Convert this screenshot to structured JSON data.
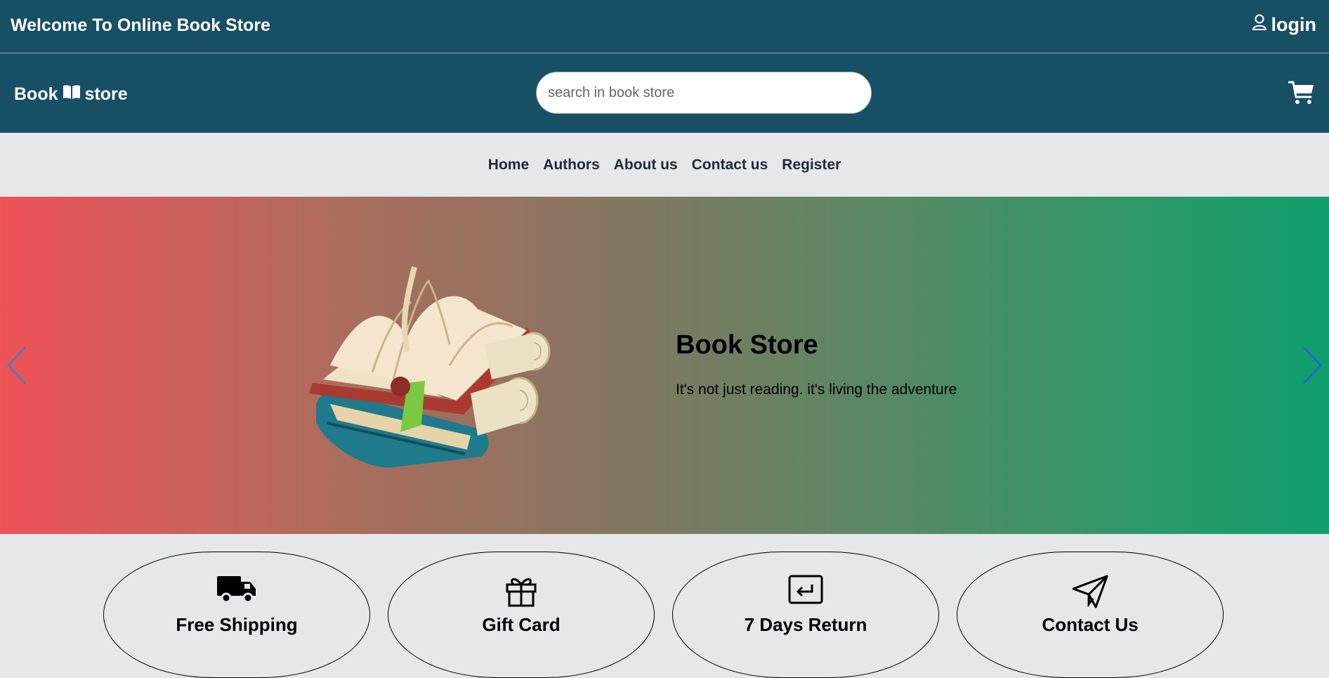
{
  "topbar": {
    "welcome": "Welcome To Online Book Store",
    "login_label": "login"
  },
  "header": {
    "logo_left": "Book",
    "logo_right": "store",
    "search_placeholder": "search in book store",
    "search_value": ""
  },
  "nav": {
    "items": [
      {
        "label": "Home"
      },
      {
        "label": "Authors"
      },
      {
        "label": "About us"
      },
      {
        "label": "Contact us"
      },
      {
        "label": "Register"
      }
    ]
  },
  "hero": {
    "title": "Book Store",
    "tagline": "It's not just reading. it's living the adventure",
    "gradient_start": "#ef5257",
    "gradient_end": "#0f9e6c",
    "arrow_color": "#1a6fd1"
  },
  "features": [
    {
      "label": "Free Shipping",
      "icon": "truck-icon"
    },
    {
      "label": "Gift Card",
      "icon": "gift-icon"
    },
    {
      "label": "7 Days Return",
      "icon": "return-icon"
    },
    {
      "label": "Contact Us",
      "icon": "paper-plane-icon"
    }
  ],
  "colors": {
    "header_bg": "#174f65",
    "page_bg": "#e5e7eb",
    "nav_text": "#1f2a37"
  }
}
